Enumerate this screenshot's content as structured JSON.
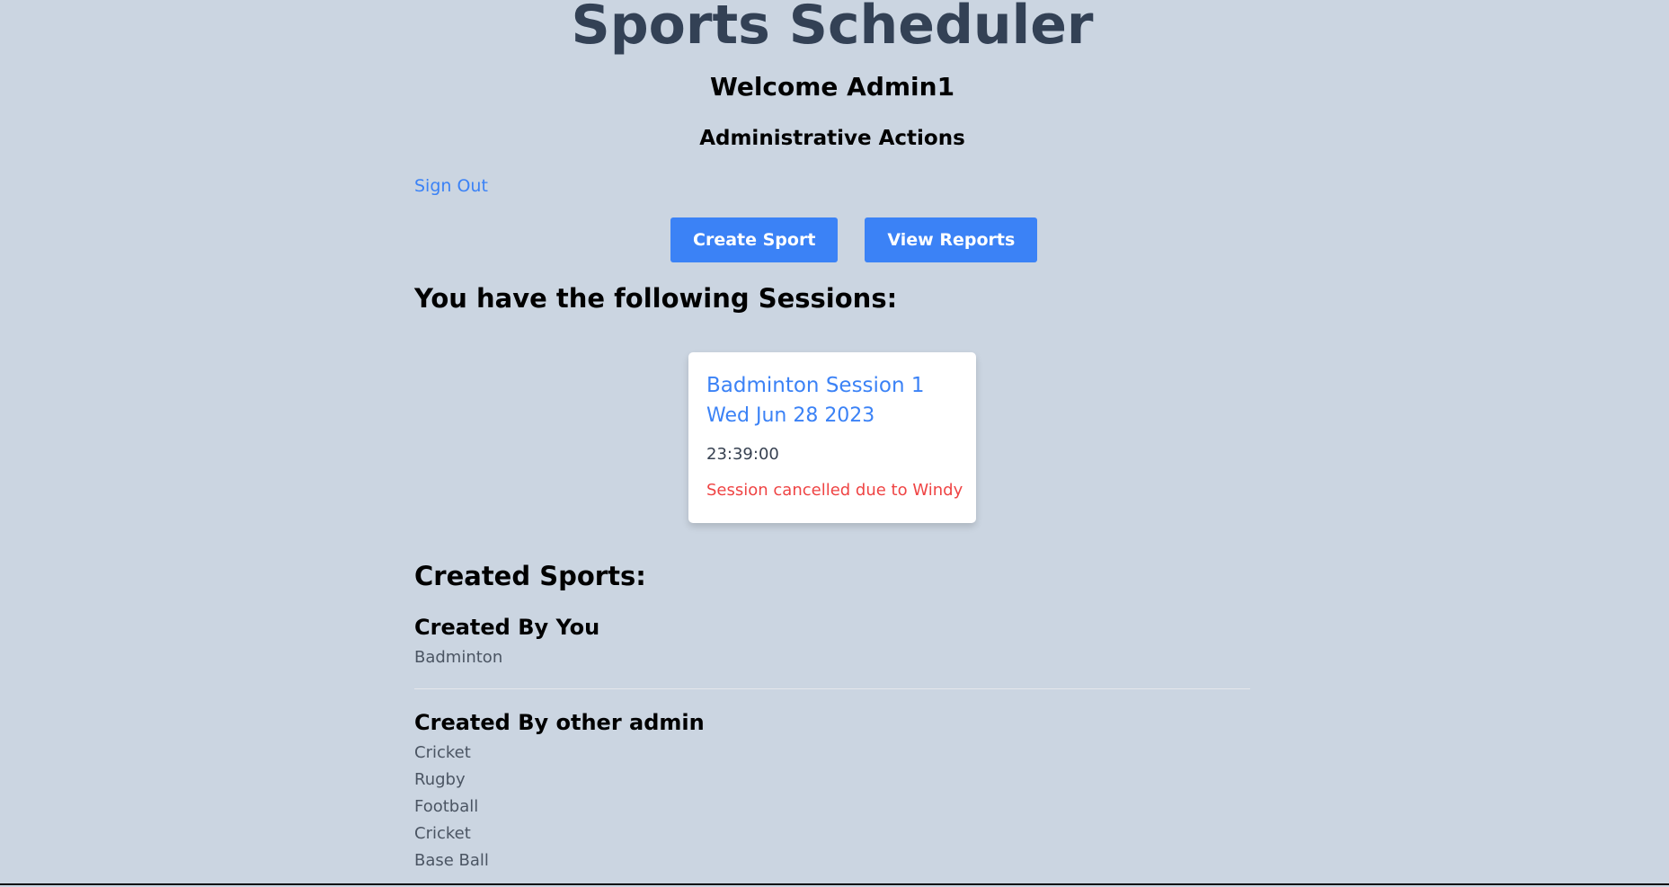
{
  "header": {
    "title": "Sports Scheduler",
    "welcome": "Welcome Admin1",
    "subtitle": "Administrative Actions"
  },
  "nav": {
    "sign_out": "Sign Out"
  },
  "actions": {
    "create_sport": "Create Sport",
    "view_reports": "View Reports"
  },
  "sessions": {
    "heading": "You have the following Sessions:",
    "items": [
      {
        "name": "Badminton Session 1",
        "date": "Wed Jun 28 2023",
        "time": "23:39:00",
        "status": "Session cancelled due to Windy"
      }
    ]
  },
  "created_sports": {
    "heading": "Created Sports:",
    "by_you": {
      "title": "Created By You",
      "sports": [
        "Badminton"
      ]
    },
    "by_other": {
      "title": "Created By other admin",
      "sports": [
        "Cricket",
        "Rugby",
        "Football",
        "Cricket",
        "Base Ball"
      ]
    }
  },
  "colors": {
    "background": "#cbd5e1",
    "primary": "#3b82f6",
    "danger": "#ef4444",
    "title": "#334155"
  }
}
